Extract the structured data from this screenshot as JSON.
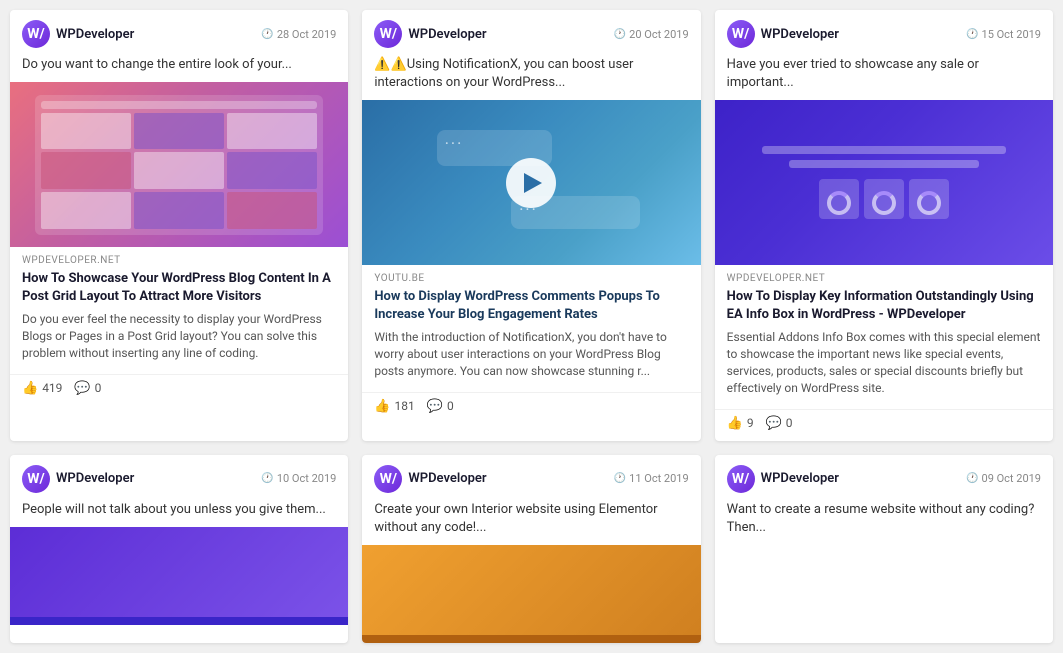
{
  "cards": [
    {
      "id": "card-1",
      "author": "WPDeveloper",
      "date": "28 Oct 2019",
      "preview_text": "Do you want to change the entire look of your...",
      "image_type": "post-grid",
      "source": "WPDEVELOPER.NET",
      "title": "How To Showcase Your WordPress Blog Content In A Post Grid Layout To Attract More Visitors",
      "description": "Do you ever feel the necessity to display your WordPress Blogs or Pages in a Post Grid layout? You can solve this problem without inserting any line of coding.",
      "likes": "419",
      "comments": "0",
      "has_stats": true
    },
    {
      "id": "card-2",
      "author": "WPDeveloper",
      "date": "20 Oct 2019",
      "preview_text": "⚠️Using NotificationX, you can boost user interactions on your WordPress...",
      "image_type": "video-comments",
      "source": "YOUTU.BE",
      "title": "How to Display WordPress Comments Popups To Increase Your Blog Engagement Rates",
      "description": "With the introduction of NotificationX, you don't have to worry about user interactions on your WordPress Blog posts anymore. You can now showcase stunning r...",
      "likes": "181",
      "comments": "0",
      "has_stats": true
    },
    {
      "id": "card-3",
      "author": "WPDeveloper",
      "date": "15 Oct 2019",
      "preview_text": "Have you ever tried to showcase any sale or important...",
      "image_type": "infobox",
      "source": "WPDEVELOPER.NET",
      "title": "How To Display Key Information Outstandingly Using EA Info Box in WordPress - WPDeveloper",
      "description": "Essential Addons Info Box comes with this special element to showcase the important news like special events, services, products, sales or special discounts briefly but effectively on WordPress site.",
      "likes": "9",
      "comments": "0",
      "has_stats": true
    },
    {
      "id": "card-4",
      "author": "WPDeveloper",
      "date": "10 Oct 2019",
      "preview_text": "People will not talk about you unless you give them...",
      "image_type": "bottom-left",
      "source": "",
      "title": "",
      "description": "",
      "has_stats": false
    },
    {
      "id": "card-5",
      "author": "WPDeveloper",
      "date": "11 Oct 2019",
      "preview_text": "Create your own Interior website using Elementor without any code!...",
      "image_type": "bottom-middle",
      "source": "",
      "title": "",
      "description": "",
      "has_stats": false
    },
    {
      "id": "card-6",
      "author": "WPDeveloper",
      "date": "09 Oct 2019",
      "preview_text": "Want to create a resume website without any coding? Then...",
      "image_type": "none",
      "source": "",
      "title": "",
      "description": "",
      "has_stats": false
    }
  ],
  "icons": {
    "clock": "🕐",
    "thumbsup": "👍",
    "comment": "💬",
    "warning": "⚠️",
    "play": "▶"
  }
}
